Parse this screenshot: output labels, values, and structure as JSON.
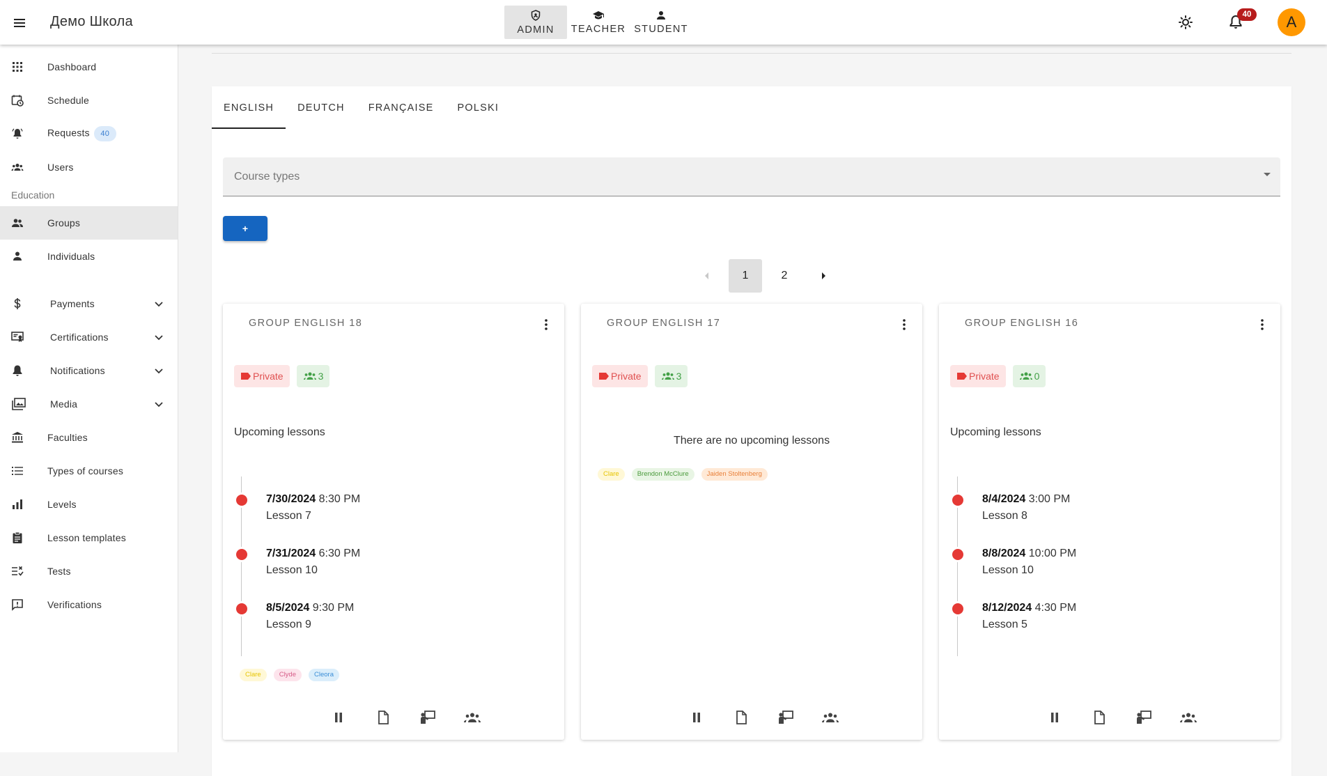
{
  "app": {
    "title": "Демо Школа"
  },
  "roles": [
    {
      "label": "ADMIN"
    },
    {
      "label": "TEACHER"
    },
    {
      "label": "STUDENT"
    }
  ],
  "notifications": {
    "count": "40"
  },
  "user": {
    "initial": "A"
  },
  "sidebar": {
    "items": [
      {
        "label": "Dashboard",
        "icon": "grid-icon"
      },
      {
        "label": "Schedule",
        "icon": "calendar-clock-icon"
      },
      {
        "label": "Requests",
        "icon": "bell-ring-icon",
        "badge": "40"
      },
      {
        "label": "Users",
        "icon": "users-icon"
      }
    ],
    "section": "Education",
    "education_items": [
      {
        "label": "Groups",
        "icon": "group-icon"
      },
      {
        "label": "Individuals",
        "icon": "person-icon"
      }
    ],
    "more_items": [
      {
        "label": "Payments",
        "icon": "dollar-icon"
      },
      {
        "label": "Certifications",
        "icon": "certificate-icon"
      },
      {
        "label": "Notifications",
        "icon": "bell-icon"
      },
      {
        "label": "Media",
        "icon": "images-icon"
      },
      {
        "label": "Faculties",
        "icon": "institution-icon"
      },
      {
        "label": "Types of courses",
        "icon": "list-icon"
      },
      {
        "label": "Levels",
        "icon": "bar-chart-icon"
      },
      {
        "label": "Lesson templates",
        "icon": "clipboard-icon"
      },
      {
        "label": "Tests",
        "icon": "checklist-icon"
      },
      {
        "label": "Verifications",
        "icon": "feedback-icon"
      }
    ]
  },
  "language_tabs": [
    {
      "label": "ENGLISH"
    },
    {
      "label": "DEUTCH"
    },
    {
      "label": "FRANÇAISE"
    },
    {
      "label": "POLSKI"
    }
  ],
  "filter": {
    "placeholder": "Course types"
  },
  "add_button": {
    "label": "+"
  },
  "pagination": {
    "pages": [
      "1",
      "2"
    ],
    "current": "1"
  },
  "cards": [
    {
      "title": "GROUP ENGLISH 18",
      "type": "Private",
      "count": "3",
      "upcoming_label": "Upcoming lessons",
      "lessons": [
        {
          "date": "7/30/2024",
          "time": "8:30 PM",
          "name": "Lesson 7"
        },
        {
          "date": "7/31/2024",
          "time": "6:30 PM",
          "name": "Lesson 10"
        },
        {
          "date": "8/5/2024",
          "time": "9:30 PM",
          "name": "Lesson 9"
        }
      ],
      "students": [
        "Clare",
        "Clyde",
        "Cleora"
      ]
    },
    {
      "title": "GROUP ENGLISH 17",
      "type": "Private",
      "count": "3",
      "no_lessons": "There are no upcoming lessons",
      "students": [
        "Clare",
        "Brendon McClure",
        "Jaiden Stoltenberg"
      ]
    },
    {
      "title": "GROUP ENGLISH 16",
      "type": "Private",
      "count": "0",
      "upcoming_label": "Upcoming lessons",
      "lessons": [
        {
          "date": "8/4/2024",
          "time": "3:00 PM",
          "name": "Lesson 8"
        },
        {
          "date": "8/8/2024",
          "time": "10:00 PM",
          "name": "Lesson 10"
        },
        {
          "date": "8/12/2024",
          "time": "4:30 PM",
          "name": "Lesson 5"
        }
      ]
    }
  ],
  "card_actions": [
    "pause-icon",
    "document-icon",
    "teacher-icon",
    "group-icon"
  ],
  "colors": {
    "accent": "#1565c0",
    "dot": "#e53935",
    "badge": "#b71c1c",
    "avatar": "#ff9800",
    "student_chip_palette": [
      {
        "bg": "#fff8d6",
        "fg": "#e6c400"
      },
      {
        "bg": "#fde4ec",
        "fg": "#d65b87"
      },
      {
        "bg": "#dbeefb",
        "fg": "#3a8dd6"
      },
      {
        "bg": "#e8f5e4",
        "fg": "#4a9a3c"
      },
      {
        "bg": "#ffe9d6",
        "fg": "#e8803a"
      }
    ]
  }
}
